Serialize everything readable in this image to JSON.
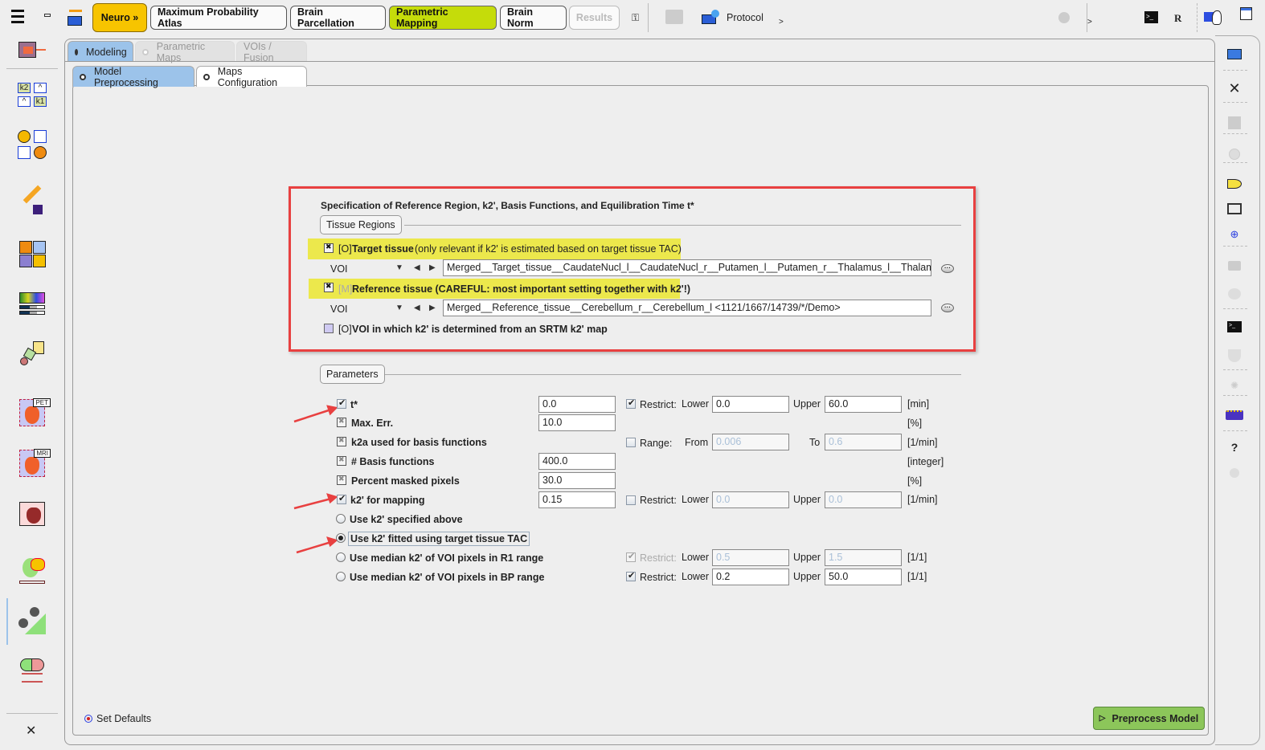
{
  "toolbar": {
    "menu_icon": "hamburger-menu-icon",
    "buttons": [
      {
        "label": "Neuro »",
        "state": "highlighted"
      },
      {
        "label": "Maximum Probability Atlas",
        "state": "normal"
      },
      {
        "label": "Brain Parcellation",
        "state": "normal"
      },
      {
        "label": "Parametric Mapping",
        "state": "active"
      },
      {
        "label": "Brain Norm",
        "state": "normal"
      },
      {
        "label": "Results",
        "state": "disabled"
      }
    ],
    "protocol_label": "Protocol",
    "more_1": ">",
    "more_2": ">",
    "r_label": "R",
    "colors": {
      "neuro": "#f7c400",
      "active": "#c5dc0a"
    }
  },
  "tabs": {
    "top": [
      {
        "label": "Modeling",
        "selected": true
      },
      {
        "label": "Parametric Maps",
        "selected": false,
        "disabled": true
      },
      {
        "label": "VOIs / Fusion",
        "selected": false,
        "disabled": true
      }
    ],
    "sub": [
      {
        "label": "Model Preprocessing",
        "selected": true
      },
      {
        "label": "Maps Configuration",
        "selected": false
      }
    ]
  },
  "spec": {
    "title": "Specification of Reference Region, k2', Basis Functions, and Equilibration Time t*",
    "tissue_regions_label": "Tissue Regions",
    "target": {
      "prefix": "[O]",
      "label": "Target tissue",
      "note": "(only relevant if k2' is estimated based on target tissue TAC)",
      "voi_label": "VOI",
      "value": "Merged__Target_tissue__CaudateNucl_l__CaudateNucl_r__Putamen_l__Putamen_r__Thalamus_l__Thalamus_r"
    },
    "reference": {
      "prefix": "[M]",
      "label": "Reference tissue (CAREFUL: most important setting together with k2'!)",
      "voi_label": "VOI",
      "value": "Merged__Reference_tissue__Cerebellum_r__Cerebellum_l <1121/1667/14739/*/Demo>"
    },
    "srtm": {
      "prefix": "[O]",
      "label": "VOI in which k2' is determined from an SRTM k2' map"
    },
    "highlight_color": "#ece84c",
    "annotation_color": "#e84040"
  },
  "parameters": {
    "label": "Parameters",
    "rows": [
      {
        "name": "t*",
        "checked": true,
        "value": "0.0",
        "restrict_label": "Restrict:",
        "restrict": true,
        "lower_label": "Lower",
        "lower": "0.0",
        "upper_label": "Upper",
        "upper": "60.0",
        "unit": "[min]"
      },
      {
        "name": "Max. Err.",
        "checked": "fixed",
        "value": "10.0",
        "unit": "[%]"
      },
      {
        "name": "k2a used for basis functions",
        "checked": "fixed",
        "range_label": "Range:",
        "range": false,
        "from_label": "From",
        "from": "0.006",
        "to_label": "To",
        "to": "0.6",
        "unit": "[1/min]"
      },
      {
        "name": "# Basis functions",
        "checked": "fixed",
        "value": "400.0",
        "unit": "[integer]"
      },
      {
        "name": "Percent masked pixels",
        "checked": "fixed",
        "value": "30.0",
        "unit": "[%]"
      },
      {
        "name": "k2' for mapping",
        "checked": true,
        "value": "0.15",
        "restrict_label": "Restrict:",
        "restrict": false,
        "lower_label": "Lower",
        "lower": "0.0",
        "upper_label": "Upper",
        "upper": "0.0",
        "unit": "[1/min]"
      }
    ],
    "options": [
      {
        "label": "Use k2' specified above",
        "selected": false
      },
      {
        "label": "Use k2' fitted using target tissue TAC",
        "selected": true
      },
      {
        "label": "Use median k2' of VOI pixels in R1 range",
        "selected": false,
        "restrict_label": "Restrict:",
        "restrict": true,
        "restrict_disabled": true,
        "lower_label": "Lower",
        "lower": "0.5",
        "upper_label": "Upper",
        "upper": "1.5",
        "unit": "[1/1]"
      },
      {
        "label": "Use median k2' of VOI pixels in BP range",
        "selected": false,
        "restrict_label": "Restrict:",
        "restrict": true,
        "lower_label": "Lower",
        "lower": "0.2",
        "upper_label": "Upper",
        "upper": "50.0",
        "unit": "[1/1]"
      }
    ]
  },
  "footer": {
    "set_defaults": "Set Defaults",
    "preprocess": "Preprocess Model",
    "preprocess_color": "#8cc65a"
  },
  "sidebar": {
    "items": [
      "database-icon",
      "k2k1-compartment-icon",
      "two-tissue-model-icon",
      "pixel-wise-modeling-icon",
      "puzzle-icon",
      "image-bars-icon",
      "3d-blocks-icon",
      "pet-cardiac-icon",
      "mri-cardiac-icon",
      "cardiac-perfusion-icon",
      "neuro-brain-icon",
      "tree-gradient-icon",
      "brain-slices-icon"
    ],
    "close_label": "✕"
  }
}
